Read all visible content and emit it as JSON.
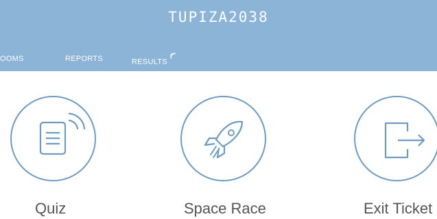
{
  "header": {
    "room_name": "TUPIZA2038",
    "nav": {
      "rooms": "OOMS",
      "reports": "REPORTS",
      "results": "RESULTS"
    }
  },
  "activities": [
    {
      "label": "Quiz",
      "icon": "quiz-icon"
    },
    {
      "label": "Space Race",
      "icon": "rocket-icon"
    },
    {
      "label": "Exit Ticket",
      "icon": "exit-ticket-icon"
    }
  ],
  "colors": {
    "header_bg": "#8cb4d6",
    "icon_stroke": "#6d9bc2",
    "label_text": "#555555"
  }
}
